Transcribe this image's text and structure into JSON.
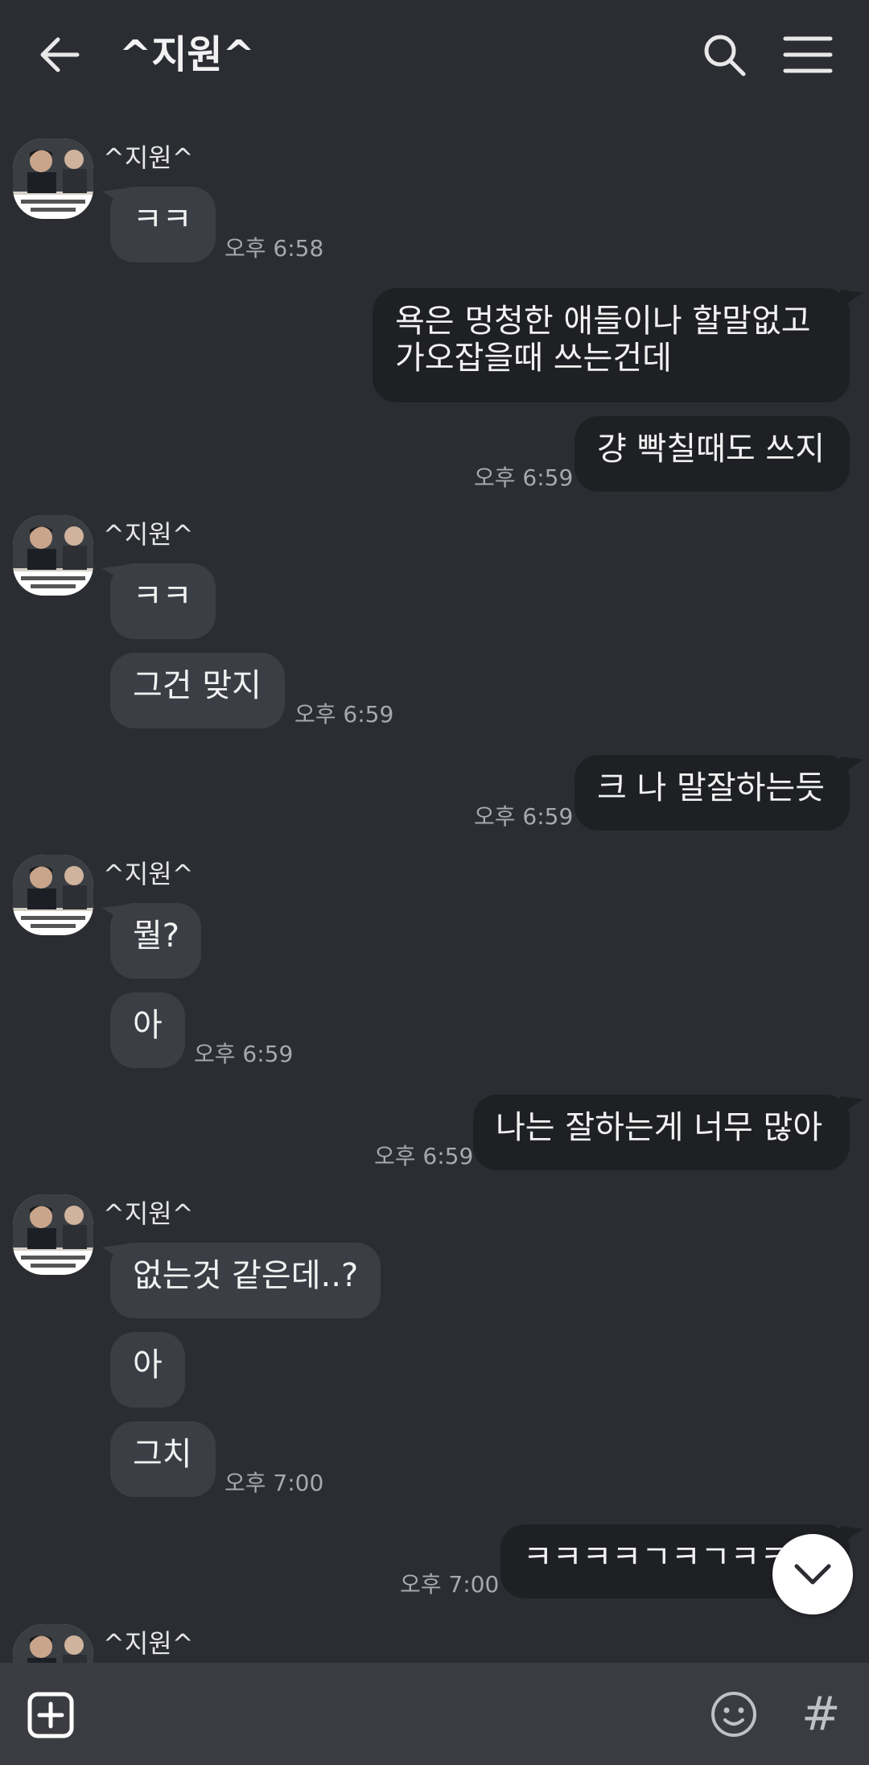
{
  "header": {
    "title": "^지원^"
  },
  "messages": {
    "sender_name": "^지원^",
    "m1": "ㅋㅋ",
    "t1": "오후 6:58",
    "m2": "욕은 멍청한 애들이나 할말없고 가오잡을때 쓰는건데",
    "m3": "걍 빡칠때도 쓰지",
    "t3": "오후 6:59",
    "m4": "ㅋㅋ",
    "m5": "그건 맞지",
    "t5": "오후 6:59",
    "m6": "크 나 말잘하는듯",
    "t6": "오후 6:59",
    "m7": "뭘?",
    "m8": "아",
    "t8": "오후 6:59",
    "m9": "나는 잘하는게 너무 많아",
    "t9": "오후 6:59",
    "m10": "없는것 같은데..?",
    "m11": "아",
    "m12": "그치",
    "t12": "오후 7:00",
    "m13": "ㅋㅋㅋㅋㄱㅋㄱㅋㅋㅋ",
    "t13": "오후 7:00"
  },
  "colors": {
    "background": "#2b2d33",
    "incoming_bubble": "#3c3e45",
    "outgoing_bubble": "#1f2023",
    "bottom_bar": "#3a3c42"
  },
  "icons": {
    "back": "arrow-left-icon",
    "search": "search-icon",
    "menu": "hamburger-menu-icon",
    "attach": "plus-square-icon",
    "emoji": "emoji-icon",
    "hash": "hash-icon",
    "scroll": "chevron-down-icon"
  },
  "composer": {
    "hash_symbol": "#"
  }
}
